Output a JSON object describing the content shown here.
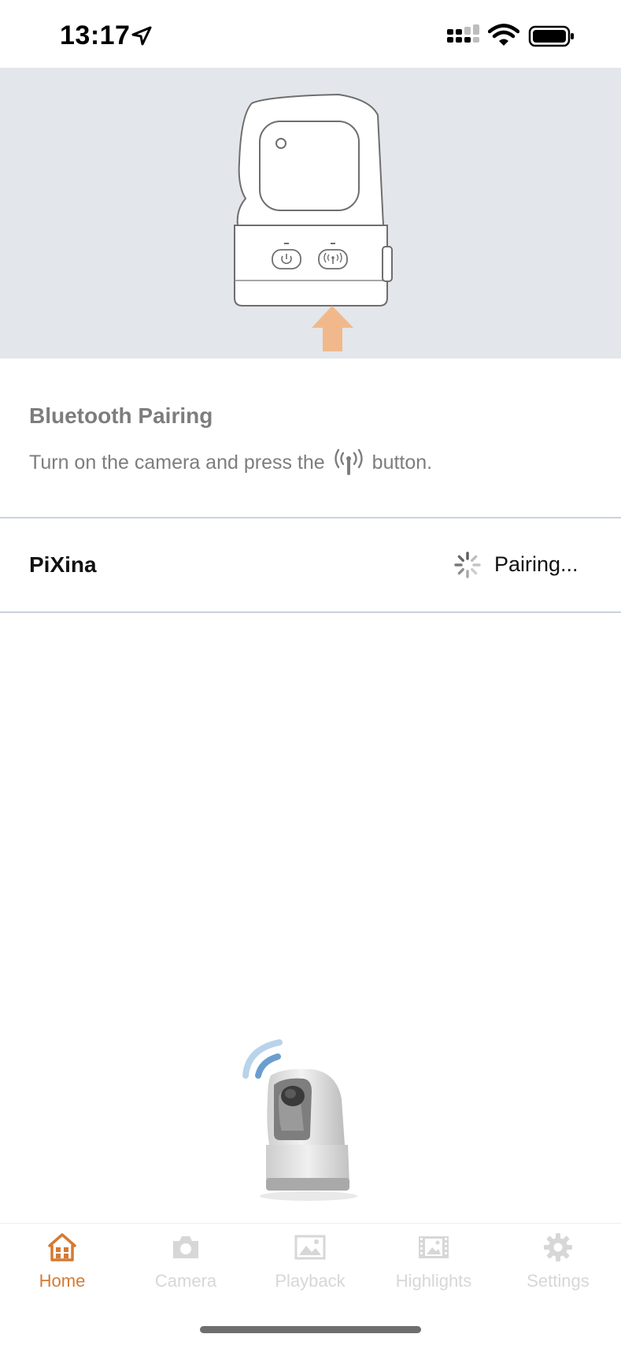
{
  "status_bar": {
    "time": "13:17"
  },
  "pairing": {
    "title": "Bluetooth Pairing",
    "instruction_before": "Turn on the camera and press the",
    "instruction_after": "button."
  },
  "device": {
    "name": "PiXina",
    "status": "Pairing..."
  },
  "tabs": [
    {
      "label": "Home",
      "icon": "home-icon",
      "active": true
    },
    {
      "label": "Camera",
      "icon": "camera-icon",
      "active": false
    },
    {
      "label": "Playback",
      "icon": "image-icon",
      "active": false
    },
    {
      "label": "Highlights",
      "icon": "film-icon",
      "active": false
    },
    {
      "label": "Settings",
      "icon": "gear-icon",
      "active": false
    }
  ],
  "colors": {
    "accent": "#d57a32",
    "hero_background": "#e3e6ea",
    "arrow": "#f1b98b",
    "inactive_tab": "#d7d7d7",
    "divider": "#c9d3dd"
  }
}
